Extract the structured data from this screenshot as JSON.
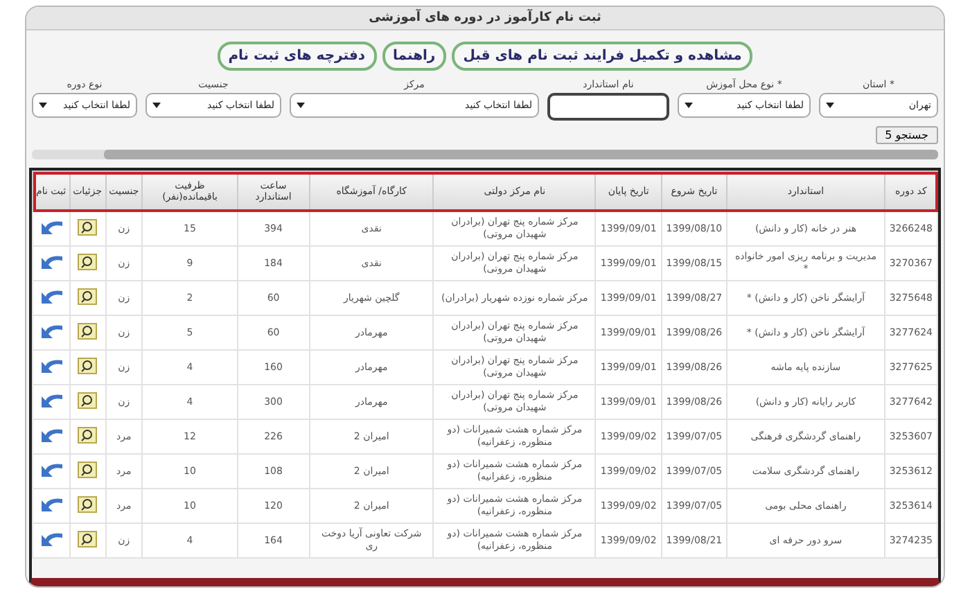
{
  "window": {
    "title": "ثبت نام کارآموز در دوره های آموزشی"
  },
  "actions": [
    "مشاهده و تکمیل فرایند ثبت نام های قبل",
    "راهنما",
    "دفترچه های ثبت نام"
  ],
  "filters": [
    {
      "kind": "select",
      "label": "* استان",
      "value": "تهران"
    },
    {
      "kind": "select",
      "label": "* نوع محل آموزش",
      "value": "لطفا انتخاب کنید"
    },
    {
      "kind": "input",
      "label": "نام استاندارد"
    },
    {
      "kind": "select",
      "label": "مرکز",
      "value": "لطفا انتخاب کنید"
    },
    {
      "kind": "select",
      "label": "جنسیت",
      "value": "لطفا انتخاب کنید"
    },
    {
      "kind": "select",
      "label": "نوع دوره",
      "value": "لطفا انتخاب کنید"
    }
  ],
  "search_button": "جستجو",
  "search_icon": "5",
  "table": {
    "columns": [
      "کد دوره",
      "استاندارد",
      "تاریخ شروع",
      "تاریخ پایان",
      "نام مرکز دولتی",
      "کارگاه/ آموزشگاه",
      "ساعت استاندارد",
      "ظرفیت باقیمانده(نفر)",
      "جنسیت",
      "جزئیات",
      "ثبت نام"
    ],
    "rows": [
      [
        "3266248",
        "هنر در خانه (کار و دانش)",
        "1399/08/10",
        "1399/09/01",
        "مرکز شماره پنج تهران (برادران شهیدان مروتی)",
        "نقدی",
        "394",
        "15",
        "زن"
      ],
      [
        "3270367",
        "مدیریت و برنامه ریزی امور خانواده *",
        "1399/08/15",
        "1399/09/01",
        "مرکز شماره پنج تهران (برادران شهیدان مروتی)",
        "نقدی",
        "184",
        "9",
        "زن"
      ],
      [
        "3275648",
        "آرایشگر ناخن (کار و دانش) *",
        "1399/08/27",
        "1399/09/01",
        "مرکز شماره نوزده شهریار (برادران)",
        "گلچین شهریار",
        "60",
        "2",
        "زن"
      ],
      [
        "3277624",
        "آرایشگر ناخن (کار و دانش) *",
        "1399/08/26",
        "1399/09/01",
        "مرکز شماره پنج تهران (برادران شهیدان مروتی)",
        "مهرمادر",
        "60",
        "5",
        "زن"
      ],
      [
        "3277625",
        "سازنده پایه ماشه",
        "1399/08/26",
        "1399/09/01",
        "مرکز شماره پنج تهران (برادران شهیدان مروتی)",
        "مهرمادر",
        "160",
        "4",
        "زن"
      ],
      [
        "3277642",
        "کاربر رایانه (کار و دانش)",
        "1399/08/26",
        "1399/09/01",
        "مرکز شماره پنج تهران (برادران شهیدان مروتی)",
        "مهرمادر",
        "300",
        "4",
        "زن"
      ],
      [
        "3253607",
        "راهنمای گردشگری فرهنگی",
        "1399/07/05",
        "1399/09/02",
        "مرکز شماره هشت شمیرانات (دو منظوره، زعفرانیه)",
        "امیران 2",
        "226",
        "12",
        "مرد"
      ],
      [
        "3253612",
        "راهنمای گردشگری سلامت",
        "1399/07/05",
        "1399/09/02",
        "مرکز شماره هشت شمیرانات (دو منظوره، زعفرانیه)",
        "امیران 2",
        "108",
        "10",
        "مرد"
      ],
      [
        "3253614",
        "راهنمای محلی بومی",
        "1399/07/05",
        "1399/09/02",
        "مرکز شماره هشت شمیرانات (دو منظوره، زعفرانیه)",
        "امیران 2",
        "120",
        "10",
        "مرد"
      ],
      [
        "3274235",
        "سرو دور حرفه ای",
        "1399/08/21",
        "1399/09/02",
        "مرکز شماره هشت شمیرانات (دو منظوره، زعفرانیه)",
        "شرکت تعاونی آریا دوخت ری",
        "164",
        "4",
        "زن"
      ]
    ]
  }
}
